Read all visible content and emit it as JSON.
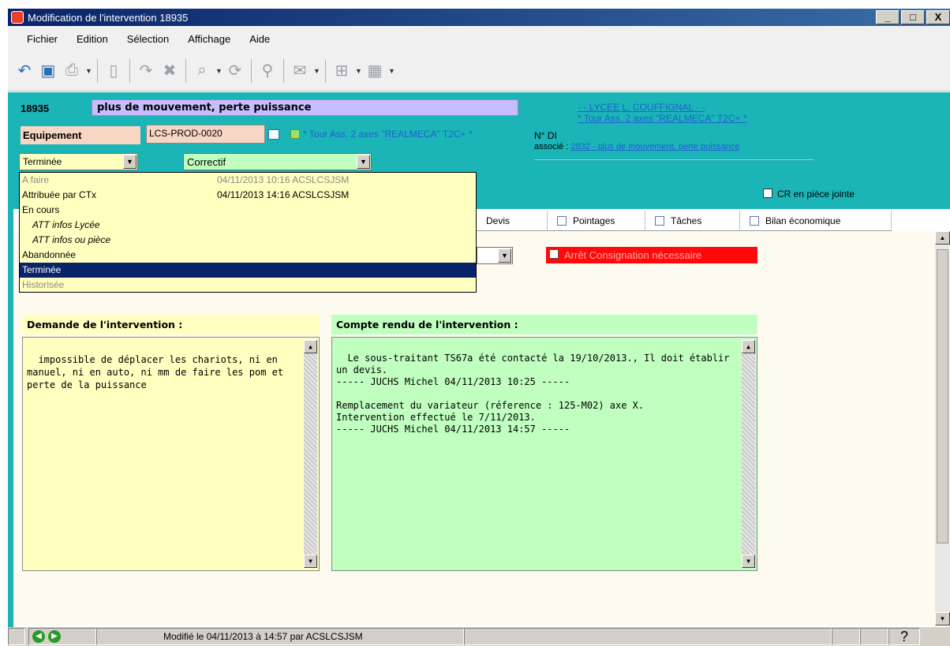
{
  "window": {
    "title": "Modification de l'intervention 18935",
    "minimize": "_",
    "maximize": "□",
    "close": "X"
  },
  "menu": [
    "Fichier",
    "Edition",
    "Sélection",
    "Affichage",
    "Aide"
  ],
  "header": {
    "id": "18935",
    "title": "plus de mouvement, perte puissance",
    "equipement_label": "Equipement",
    "equipement_code": "LCS-PROD-0020",
    "equipement_desc": "* Tour Ass. 2 axes \"REALMECA\" T2C+ *",
    "site_link": "- - LYCEE L. COUFFIGNAL - -",
    "machine_link": "* Tour Ass. 2 axes \"REALMECA\" T2C+ *",
    "ndi_label": "N° DI",
    "associe_label": "associé :",
    "associe_link": "2832 - plus de mouvement, perte puissance",
    "status_value": "Terminée",
    "type_value": "Correctif",
    "cr_checkbox_label": "CR en pièce jointe"
  },
  "status_dropdown": [
    {
      "label": "A faire",
      "date": "04/11/2013 10:16 ACSLCSJSM",
      "state": "disabled"
    },
    {
      "label": "Attribuée par CTx",
      "date": "04/11/2013 14:16 ACSLCSJSM",
      "state": "normal"
    },
    {
      "label": "En cours",
      "date": "",
      "state": "normal"
    },
    {
      "label": "ATT infos Lycée",
      "date": "",
      "state": "indent"
    },
    {
      "label": "ATT infos ou pièce",
      "date": "",
      "state": "indent"
    },
    {
      "label": "Abandonnée",
      "date": "",
      "state": "normal"
    },
    {
      "label": "Terminée",
      "date": "",
      "state": "selected"
    },
    {
      "label": "Historisée",
      "date": "",
      "state": "disabled"
    }
  ],
  "tabs": [
    "Devis",
    "Pointages",
    "Tâches",
    "Bilan économique"
  ],
  "arret_label": "Arrêt Consignation  nécessaire",
  "demande": {
    "label": "Demande de l'intervention  :",
    "text": "impossible de déplacer les chariots, ni en manuel, ni en auto, ni mm de faire les pom et perte de la puissance"
  },
  "compte_rendu": {
    "label": "Compte rendu de l'intervention  :",
    "text": "Le sous-traitant TS67a été contacté la 19/10/2013., Il doit établir un devis.\n----- JUCHS Michel 04/11/2013 10:25 -----\n\nRemplacement du variateur (réference : 125-M02) axe X.\nIntervention effectué le 7/11/2013.\n----- JUCHS Michel 04/11/2013 14:57 -----"
  },
  "statusbar": {
    "modified": "Modifié le 04/11/2013 à 14:57 par ACSLCSJSM",
    "help": "?"
  },
  "colors": {
    "header_bg": "#1bb5b8",
    "title_field": "#c8bcff",
    "yellow": "#ffffc0",
    "green": "#c0ffc0",
    "selected": "#0a246a",
    "alert": "#ff0a0a"
  }
}
